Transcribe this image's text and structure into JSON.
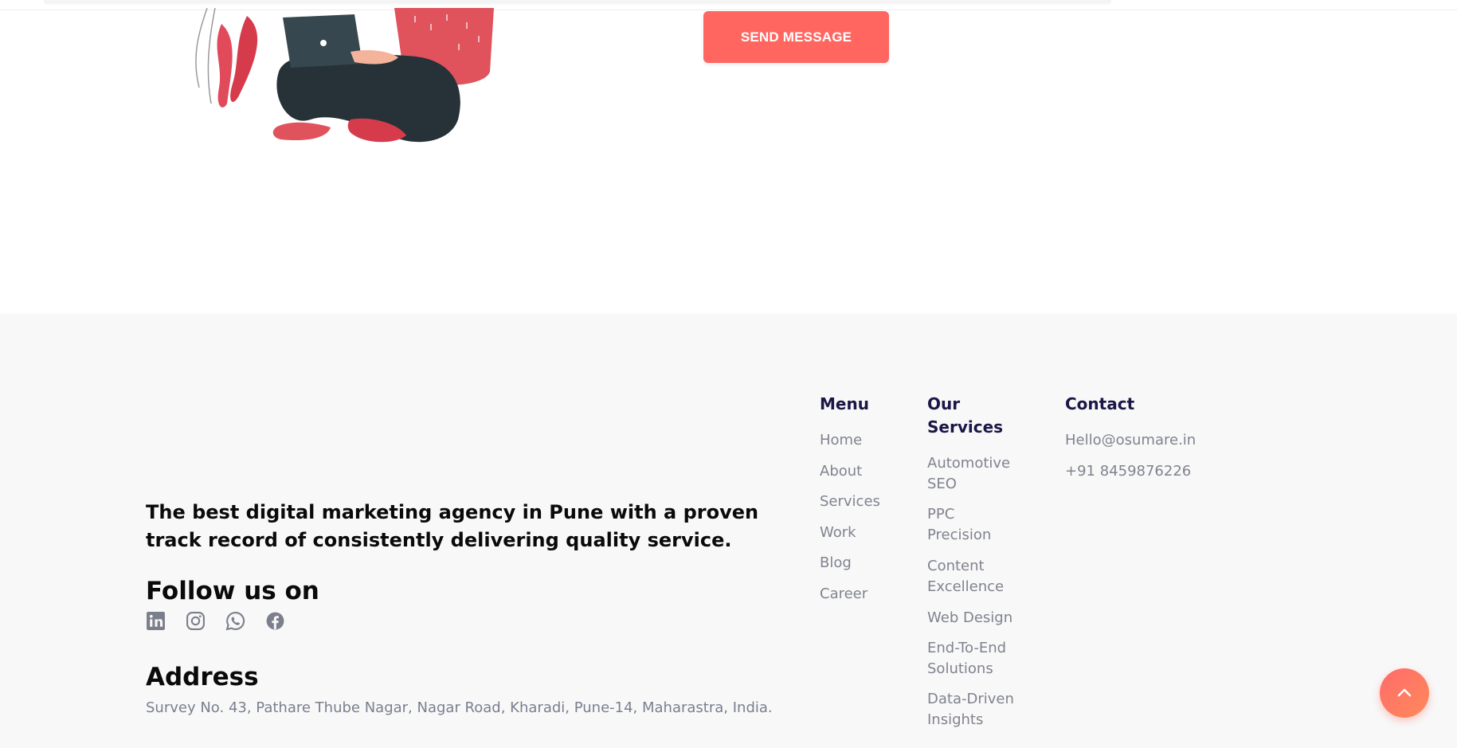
{
  "contact_form": {
    "send_label": "SEND MESSAGE"
  },
  "footer": {
    "tagline": "The best digital marketing agency in Pune with a proven track record of consistently delivering quality service.",
    "follow_heading": "Follow us on",
    "social": [
      {
        "name": "linkedin-icon"
      },
      {
        "name": "instagram-icon"
      },
      {
        "name": "whatsapp-icon"
      },
      {
        "name": "facebook-icon"
      }
    ],
    "address_heading": "Address",
    "address": "Survey No. 43, Pathare Thube Nagar, Nagar Road, Kharadi, Pune-14, Maharastra, India.",
    "menu": {
      "heading": "Menu",
      "items": [
        "Home",
        "About",
        "Services",
        "Work",
        "Blog",
        "Career"
      ]
    },
    "services": {
      "heading_line1": "Our",
      "heading_line2": "Services",
      "items": [
        {
          "line1": "Automotive",
          "line2": "SEO"
        },
        {
          "line1": "PPC",
          "line2": "Precision"
        },
        {
          "line1": "Content",
          "line2": "Excellence"
        },
        {
          "line1": "Web Design",
          "line2": ""
        },
        {
          "line1": "End-To-End",
          "line2": "Solutions"
        },
        {
          "line1": "Data-Driven",
          "line2": "Insights"
        }
      ]
    },
    "contact": {
      "heading": "Contact",
      "email": "Hello@osumare.in",
      "phone": "+91 8459876226"
    }
  },
  "colors": {
    "accent": "#ff6660",
    "footer_bg": "#f8f8f8",
    "heading_navy": "#1a1646",
    "link_gray": "#80838f"
  }
}
